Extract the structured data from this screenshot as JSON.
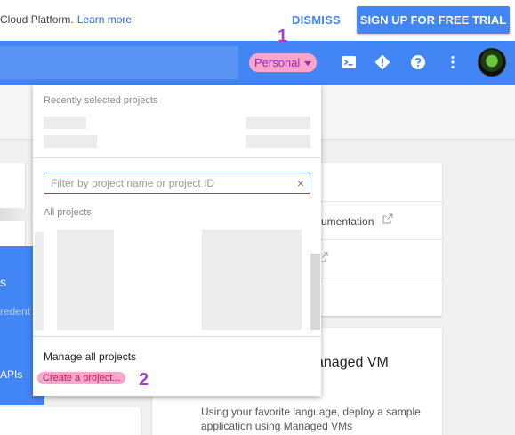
{
  "banner": {
    "text": "Cloud Platform.",
    "link": "Learn more",
    "dismiss": "DISMISS",
    "signup": "SIGN UP FOR FREE TRIAL"
  },
  "header": {
    "project_selector": "Personal",
    "icons": [
      "cloud-shell-icon",
      "notifications-icon",
      "help-icon",
      "more-vert-icon",
      "avatar"
    ]
  },
  "annotations": {
    "step1": "1",
    "step2": "2"
  },
  "dropdown": {
    "recent_title": "Recently selected projects",
    "filter_placeholder": "Filter by project name or project ID",
    "clear": "×",
    "all_title": "All projects",
    "manage": "Manage all projects",
    "create": "Create a project..."
  },
  "background": {
    "blue_card": {
      "line1": "s",
      "line2": "redent",
      "line3": "APIs"
    },
    "doc_link": "umentation",
    "vm_title": "anaged VM",
    "vm_desc": "Using your favorite language, deploy a sample application using Managed VMs"
  },
  "colors": {
    "primary": "#4285f4",
    "highlight": "#f8a6cc",
    "annotation": "#a53fd0"
  }
}
